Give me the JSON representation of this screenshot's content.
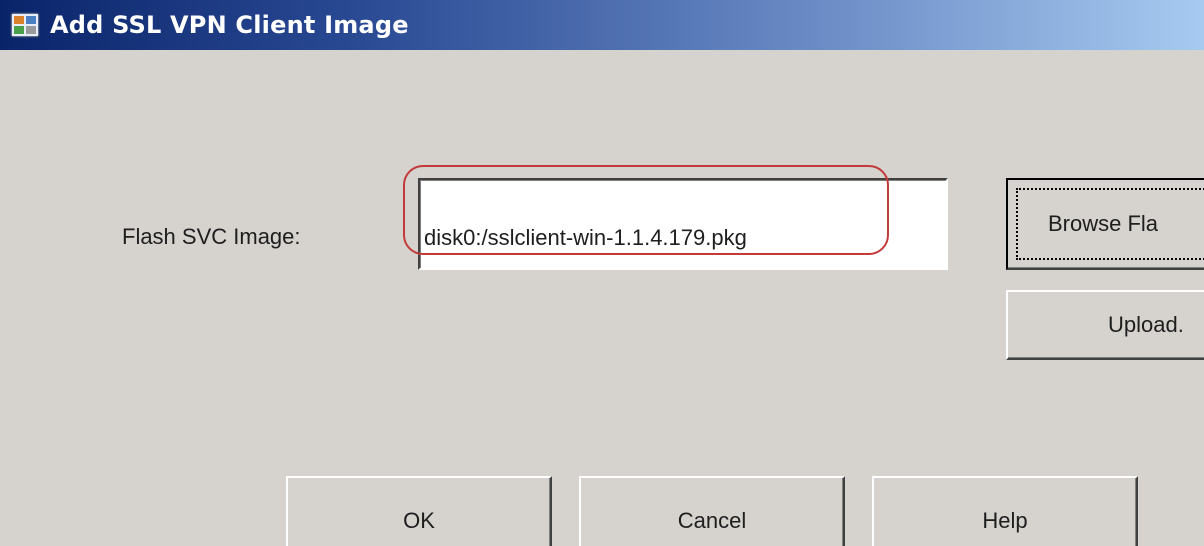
{
  "window": {
    "title": "Add SSL VPN Client Image",
    "icon": "asdm-app-icon"
  },
  "form": {
    "flash_svc_label": "Flash SVC Image:",
    "flash_svc_value": "disk0:/sslclient-win-1.1.4.179.pkg"
  },
  "buttons": {
    "browse_flash": "Browse Fla",
    "upload": "Upload.",
    "ok": "OK",
    "cancel": "Cancel",
    "help": "Help"
  },
  "colors": {
    "titlebar_start": "#0a246a",
    "titlebar_end": "#a6caf0",
    "dialog_bg": "#d6d3ce",
    "highlight_ring": "#c23a3a"
  }
}
